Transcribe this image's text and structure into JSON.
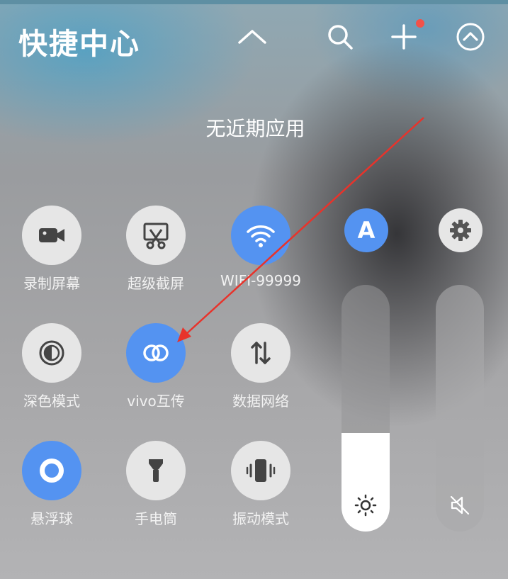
{
  "header": {
    "title": "快捷中心",
    "icons": [
      "chevron-up-icon",
      "search-icon",
      "add-icon",
      "collapse-icon"
    ],
    "notification_dot": true
  },
  "recent": {
    "empty_text": "无近期应用"
  },
  "tiles": [
    {
      "label": "录制屏幕",
      "icon": "video-camera-icon",
      "active": false
    },
    {
      "label": "超级截屏",
      "icon": "scissors-screenshot-icon",
      "active": false
    },
    {
      "label": "WIFI-99999",
      "icon": "wifi-icon",
      "active": true
    },
    {
      "label": "深色模式",
      "icon": "dark-mode-icon",
      "active": false
    },
    {
      "label": "vivo互传",
      "icon": "link-rings-icon",
      "active": true
    },
    {
      "label": "数据网络",
      "icon": "data-arrows-icon",
      "active": false
    },
    {
      "label": "悬浮球",
      "icon": "floating-ball-icon",
      "active": true
    },
    {
      "label": "手电筒",
      "icon": "flashlight-icon",
      "active": false
    },
    {
      "label": "振动模式",
      "icon": "vibrate-icon",
      "active": false
    }
  ],
  "side_controls": {
    "auto_brightness": {
      "glyph": "A",
      "active": true
    },
    "settings": {
      "icon": "gear-icon"
    }
  },
  "sliders": {
    "brightness": {
      "level": 0.4,
      "icon": "sun-icon"
    },
    "volume": {
      "level": 0,
      "icon": "mute-icon"
    }
  },
  "colors": {
    "accent": "#5493f1",
    "tile_off": "#e6e6e6",
    "annotation_arrow": "#e8332b",
    "notification_dot": "#f35148"
  }
}
